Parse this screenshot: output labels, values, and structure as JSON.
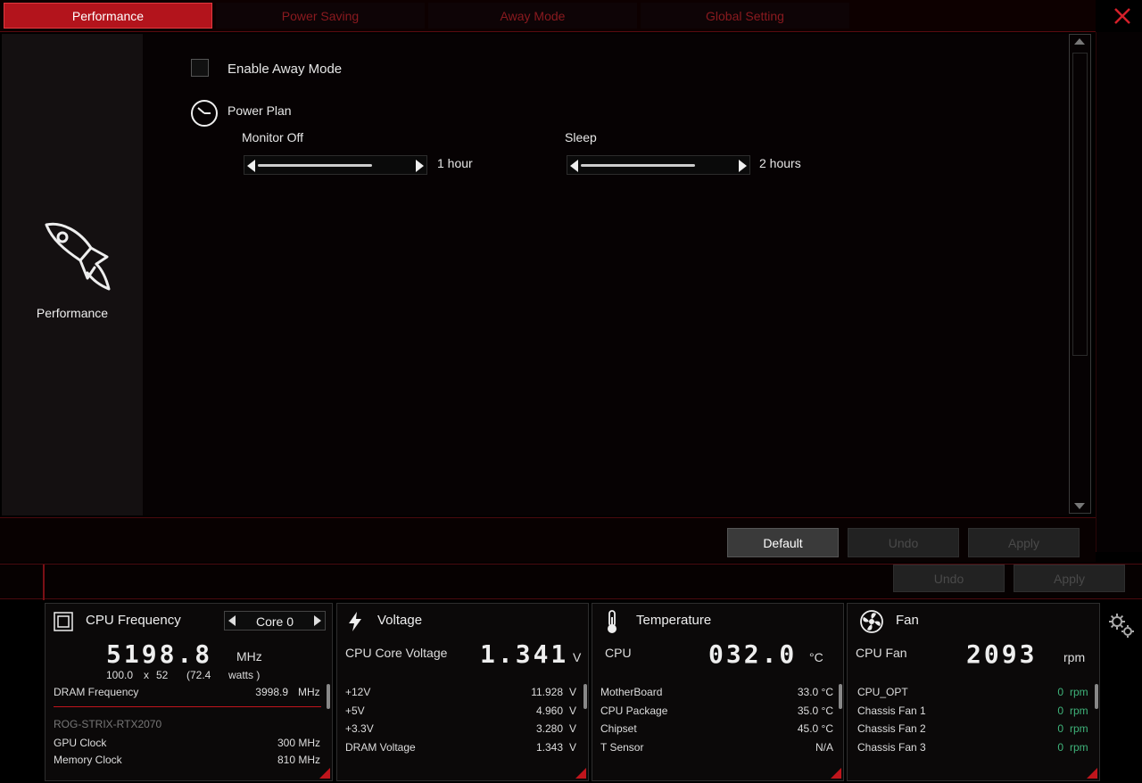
{
  "tabs": [
    {
      "label": "Performance",
      "active": true
    },
    {
      "label": "Power Saving",
      "active": false
    },
    {
      "label": "Away Mode",
      "active": false
    },
    {
      "label": "Global Setting",
      "active": false
    }
  ],
  "sidebar": {
    "label": "Performance",
    "icon": "rocket-icon"
  },
  "content": {
    "enable_away_mode": {
      "label": "Enable Away Mode",
      "checked": false
    },
    "power_plan": {
      "label": "Power Plan",
      "icon": "clock-icon"
    },
    "monitor_off": {
      "label": "Monitor Off",
      "value": "1 hour"
    },
    "sleep": {
      "label": "Sleep",
      "value": "2 hours"
    }
  },
  "buttons_main": {
    "default": "Default",
    "undo": "Undo",
    "apply": "Apply"
  },
  "buttons_global": {
    "undo": "Undo",
    "apply": "Apply"
  },
  "cpu_frequency": {
    "title": "CPU Frequency",
    "core": "Core 0",
    "value": "5198.8",
    "unit": "MHz",
    "multiplier": "100.0",
    "x": "x",
    "ratio": "52",
    "watts_open": "(72.4",
    "watts_label": "watts )",
    "dram_label": "DRAM Frequency",
    "dram_value": "3998.9",
    "dram_unit": "MHz",
    "gpu_name": "ROG-STRIX-RTX2070",
    "gpu_clock_label": "GPU Clock",
    "gpu_clock_value": "300 MHz",
    "mem_clock_label": "Memory Clock",
    "mem_clock_value": "810 MHz"
  },
  "voltage": {
    "title": "Voltage",
    "core_label": "CPU Core Voltage",
    "core_value": "1.341",
    "core_unit": "V",
    "rows": [
      {
        "label": "+12V",
        "value": "11.928",
        "unit": "V"
      },
      {
        "label": "+5V",
        "value": "4.960",
        "unit": "V"
      },
      {
        "label": "+3.3V",
        "value": "3.280",
        "unit": "V"
      },
      {
        "label": "DRAM Voltage",
        "value": "1.343",
        "unit": "V"
      }
    ]
  },
  "temperature": {
    "title": "Temperature",
    "cpu_label": "CPU",
    "cpu_value": "032.0",
    "cpu_unit": "°C",
    "rows": [
      {
        "label": "MotherBoard",
        "value": "33.0 °C"
      },
      {
        "label": "CPU Package",
        "value": "35.0 °C"
      },
      {
        "label": "Chipset",
        "value": "45.0 °C"
      },
      {
        "label": "T Sensor",
        "value": "N/A"
      }
    ]
  },
  "fan": {
    "title": "Fan",
    "cpu_label": "CPU Fan",
    "cpu_value": "2093",
    "cpu_unit": "rpm",
    "rows": [
      {
        "label": "CPU_OPT",
        "value": "0",
        "unit": "rpm"
      },
      {
        "label": "Chassis Fan 1",
        "value": "0",
        "unit": "rpm"
      },
      {
        "label": "Chassis Fan 2",
        "value": "0",
        "unit": "rpm"
      },
      {
        "label": "Chassis Fan 3",
        "value": "0",
        "unit": "rpm"
      }
    ]
  },
  "colors": {
    "accent": "#b3141c",
    "positive": "#3fb37a"
  }
}
